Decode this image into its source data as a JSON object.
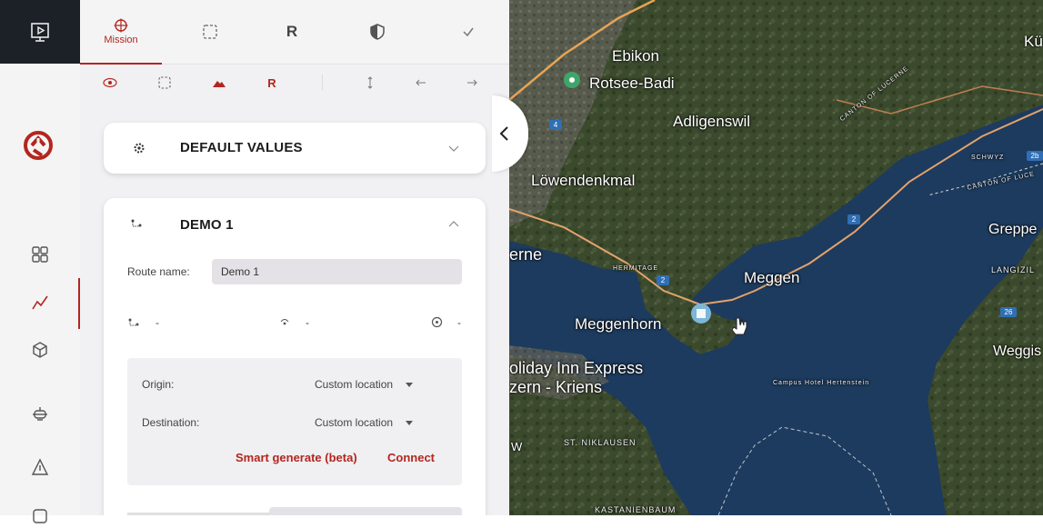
{
  "tabs": [
    {
      "label": "Mission",
      "icon": "crosshair-icon",
      "active": true
    },
    {
      "label": "",
      "icon": "select-area-icon"
    },
    {
      "label": "R",
      "icon": "r-letter-icon"
    },
    {
      "label": "",
      "icon": "shield-icon"
    },
    {
      "label": "",
      "icon": "check-icon"
    }
  ],
  "toolbar_icons": [
    "eye-icon",
    "select-area-icon",
    "terrain-icon",
    "r-letter-icon",
    "vertical-arrows-icon",
    "arrow-left-icon",
    "arrow-right-icon"
  ],
  "default_values": {
    "title": "DEFAULT VALUES"
  },
  "demo": {
    "title": "DEMO 1",
    "route_label": "Route name:",
    "route_value": "Demo 1",
    "stat1": "-",
    "stat2": "-",
    "stat3": "-",
    "origin_label": "Origin:",
    "origin_value": "Custom location",
    "destination_label": "Destination:",
    "destination_value": "Custom location",
    "smart_generate": "Smart generate (beta)",
    "connect": "Connect"
  },
  "map": {
    "labels": {
      "ebikon": "Ebikon",
      "rotsee": "Rotsee-Badi",
      "adligenswil": "Adligenswil",
      "loewendenkmal": "Löwendenkmal",
      "meggen": "Meggen",
      "meggenhorn": "Meggenhorn",
      "holiday_inn": "oliday Inn Express",
      "kriens": "zern - Kriens",
      "st_niklausen": "ST. NIKLAUSEN",
      "kastanienbaum": "KASTANIENBAUM",
      "greppen": "Greppe",
      "langizil": "LANGIZIL",
      "weggis": "Weggis",
      "kuessnacht": "Kü",
      "luzern": "erne",
      "hermitage": "HERMITAGE",
      "campus_hotel": "Campus Hotel Hertenstein",
      "canton_lucerne": "CANTON OF LUCERNE",
      "schwyz": "SCHWYZ",
      "canton_luc2": "CANTON OF LUCE",
      "w_label": "W"
    },
    "road_badges": [
      "2",
      "2",
      "4",
      "2",
      "2b",
      "2b",
      "26"
    ]
  },
  "colors": {
    "accent": "#b3261e",
    "rail_dark": "#1c2128",
    "lake": "#1d3b5e",
    "land": "#3c4a2c"
  }
}
